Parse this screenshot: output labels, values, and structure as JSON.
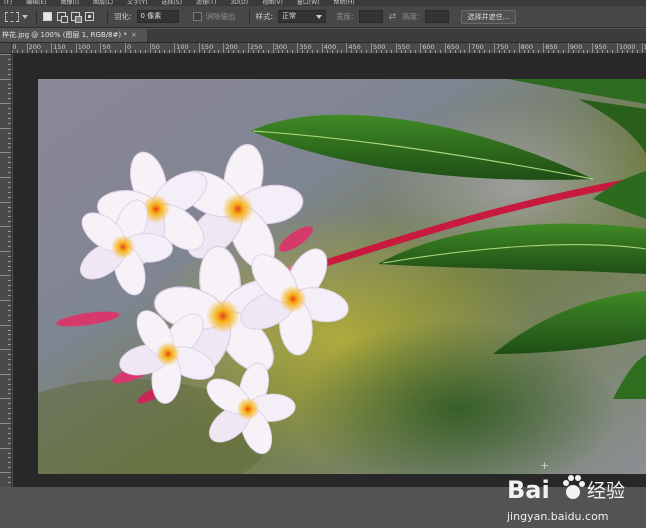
{
  "menubar": {
    "items": [
      "(F)",
      "编辑(E)",
      "图像(I)",
      "图层(L)",
      "文字(Y)",
      "选择(S)",
      "滤镜(T)",
      "3D(D)",
      "视图(V)",
      "窗口(W)",
      "帮助(H)"
    ]
  },
  "options": {
    "feather_label": "羽化:",
    "feather_value": "0 像素",
    "antialias_label": "消除锯齿",
    "style_label": "样式:",
    "style_value": "正常",
    "width_label": "宽度:",
    "height_label": "高度:",
    "select_mask_button": "选择并遮住..."
  },
  "document": {
    "tab_title": "梓花.jpg @ 100% (图层 1, RGB/8#) *",
    "tab_close": "×"
  },
  "ruler": {
    "h_labels": [
      "250",
      "200",
      "150",
      "100",
      "50",
      "0",
      "50",
      "100",
      "150",
      "200",
      "250",
      "300",
      "350",
      "400",
      "450",
      "500",
      "550",
      "600",
      "650",
      "700",
      "750",
      "800",
      "850",
      "900",
      "950",
      "1000",
      "1050",
      "1100",
      "1150",
      "1200",
      "1250",
      "1300",
      "1350",
      "1400",
      "1450",
      "1500",
      "1550",
      "1600",
      "1650",
      "1700",
      "1750",
      "1800",
      "1850",
      "1900",
      "1950",
      "2000",
      "2050",
      "2100"
    ]
  },
  "watermark": {
    "brand": "Bai",
    "brand_suffix": "经验",
    "url": "jingyan.baidu.com"
  },
  "colors": {
    "app_bg": "#535353",
    "canvas_bg": "#282828",
    "petal": "#f6f2f8",
    "petal_shade": "#d7c6e0",
    "flower_center": "#f5b318",
    "bud": "#d63a6c",
    "stem": "#c8193f",
    "leaf": "#2f6e1e"
  }
}
